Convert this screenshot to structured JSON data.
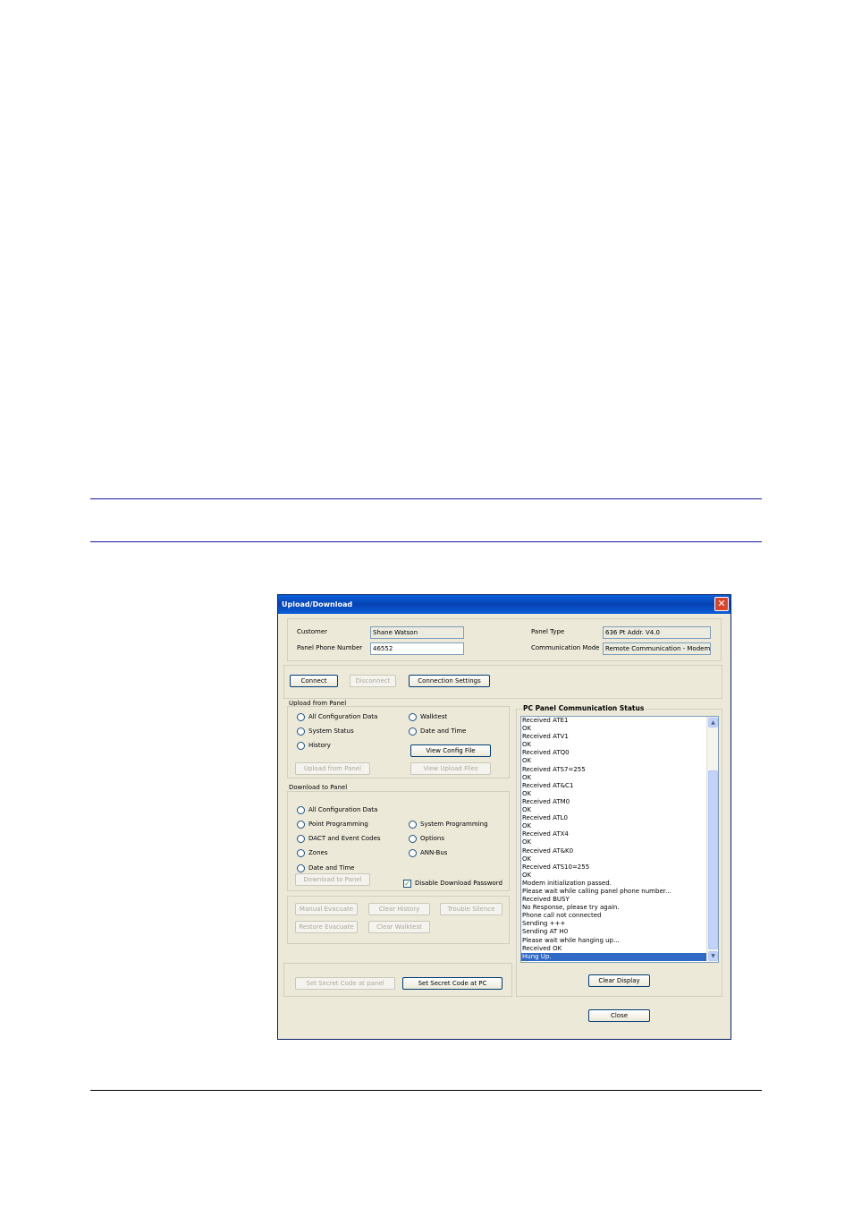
{
  "window": {
    "title": "Upload/Download",
    "close_glyph": "✕"
  },
  "header": {
    "customer_label": "Customer",
    "customer_value": "Shane Watson",
    "phone_label": "Panel Phone Number",
    "phone_value": "46552",
    "panel_type_label": "Panel Type",
    "panel_type_value": "636 Pt Addr. V4.0",
    "comm_mode_label": "Communication Mode",
    "comm_mode_value": "Remote Communication - Modem"
  },
  "connection": {
    "connect": "Connect",
    "disconnect": "Disconnect",
    "settings": "Connection Settings"
  },
  "upload": {
    "heading": "Upload from Panel",
    "options": [
      "All Configuration Data",
      "System Status",
      "History",
      "Walktest",
      "Date and Time"
    ],
    "view_config": "View Config File",
    "upload_button": "Upload from Panel",
    "view_upload": "View Upload Files"
  },
  "download": {
    "heading": "Download to Panel",
    "options": [
      "All Configuration Data",
      "Point Programming",
      "DACT and Event Codes",
      "Zones",
      "Date and Time",
      "System Programming",
      "Options",
      "ANN-Bus"
    ],
    "download_button": "Download to Panel",
    "disable_password": "Disable Download Password",
    "disable_password_checked": true
  },
  "actions": {
    "manual_evacuate": "Manual Evacuate",
    "clear_history": "Clear History",
    "trouble_silence": "Trouble Silence",
    "restore_evacuate": "Restore Evacuate",
    "clear_walktest": "Clear Walktest"
  },
  "secret": {
    "at_panel": "Set Secret Code at panel",
    "at_pc": "Set Secret Code at PC"
  },
  "status": {
    "heading": "PC Panel Communication Status",
    "lines": [
      "Received ATE1",
      "OK",
      "Received ATV1",
      "OK",
      "Received ATQ0",
      "OK",
      "Received ATS7=255",
      "OK",
      "Received AT&C1",
      "OK",
      "Received ATM0",
      "OK",
      "Received ATL0",
      "OK",
      "Received ATX4",
      "OK",
      "Received AT&K0",
      "OK",
      "Received ATS10=255",
      "OK",
      "Modem initialization passed.",
      "Please wait while calling panel phone number...",
      "Received BUSY",
      "No Response, please try again.",
      "Phone call not connected",
      "Sending +++",
      "Sending AT H0",
      "Please wait while hanging up...",
      "Received    OK",
      "Hung Up."
    ],
    "selected_line": "Hung Up.",
    "clear_display": "Clear Display",
    "close": "Close",
    "scroll_up_glyph": "▲",
    "scroll_down_glyph": "▼"
  }
}
